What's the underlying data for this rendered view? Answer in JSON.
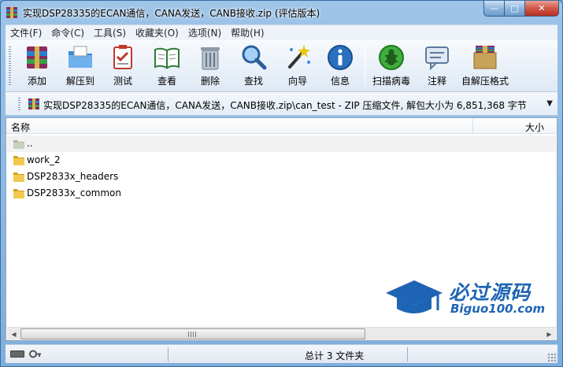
{
  "window": {
    "title": "实现DSP28335的ECAN通信，CANA发送，CANB接收.zip (评估版本)",
    "min_label": "—",
    "max_label": "□",
    "close_label": "✕"
  },
  "menu": {
    "items": [
      "文件(F)",
      "命令(C)",
      "工具(S)",
      "收藏夹(O)",
      "选项(N)",
      "帮助(H)"
    ]
  },
  "toolbar": {
    "items": [
      {
        "label": "添加",
        "icon": "add-archive-icon"
      },
      {
        "label": "解压到",
        "icon": "extract-to-icon"
      },
      {
        "label": "测试",
        "icon": "test-icon"
      },
      {
        "label": "查看",
        "icon": "view-icon"
      },
      {
        "label": "删除",
        "icon": "delete-icon"
      },
      {
        "label": "查找",
        "icon": "find-icon"
      },
      {
        "label": "向导",
        "icon": "wizard-icon"
      },
      {
        "label": "信息",
        "icon": "info-icon"
      },
      {
        "label": "扫描病毒",
        "icon": "virus-scan-icon"
      },
      {
        "label": "注释",
        "icon": "comment-icon"
      },
      {
        "label": "自解压格式",
        "icon": "sfx-icon"
      }
    ]
  },
  "address": {
    "path": "实现DSP28335的ECAN通信，CANA发送，CANB接收.zip\\can_test - ZIP 压缩文件, 解包大小为 6,851,368 字节",
    "dropdown": "▼"
  },
  "filelist": {
    "col_name": "名称",
    "col_size": "大小",
    "rows": [
      {
        "name": ".."
      },
      {
        "name": "work_2"
      },
      {
        "name": "DSP2833x_headers"
      },
      {
        "name": "DSP2833x_common"
      }
    ]
  },
  "scrollbar": {
    "left": "◀",
    "right": "▶"
  },
  "watermark": {
    "cn": "必过源码",
    "en": "Biguo100.com"
  },
  "status": {
    "summary": "总计 3 文件夹"
  },
  "colors": {
    "accent": "#1e64b4",
    "folder": "#e8b838"
  }
}
